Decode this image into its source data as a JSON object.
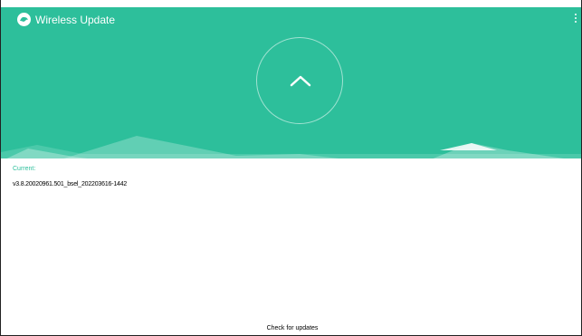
{
  "header": {
    "title": "Wireless Update",
    "app_icon": "app-logo-icon",
    "menu_icon": "overflow-menu-icon",
    "accent_color": "#2dbf9b"
  },
  "main": {
    "update_button_icon": "chevron-up-icon",
    "current_label": "Current:",
    "current_version": "v3.8.20020961.501_bsel_202203616-1442"
  },
  "footer": {
    "check_label": "Check for updates"
  }
}
